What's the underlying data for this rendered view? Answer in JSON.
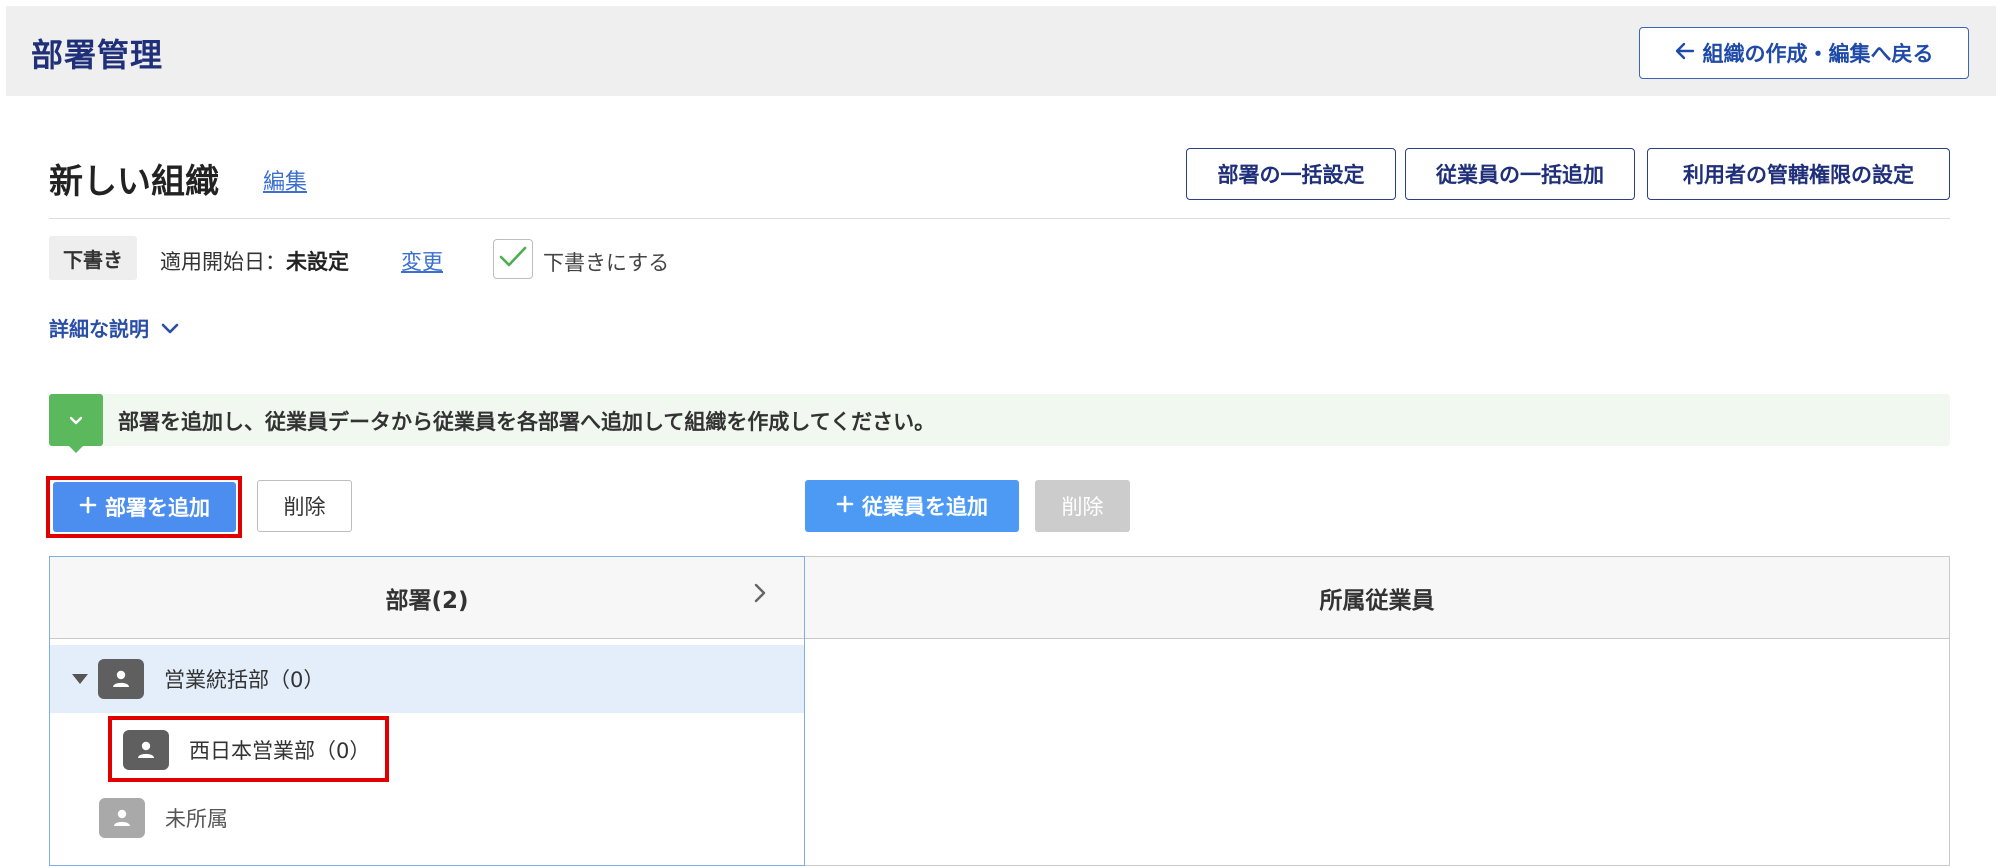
{
  "header": {
    "title": "部署管理",
    "back_button_label": "組織の作成・編集へ戻る"
  },
  "organization": {
    "name": "新しい組織",
    "edit_link": "編集"
  },
  "toolbar": {
    "bulk_dept_label": "部署の一括設定",
    "bulk_emp_label": "従業員の一括追加",
    "admin_perm_label": "利用者の管轄権限の設定"
  },
  "status": {
    "draft_badge": "下書き",
    "start_date_label": "適用開始日：",
    "start_date_value": "未設定",
    "change_link": "変更",
    "draft_checkbox_label": "下書きにする",
    "draft_checked": true
  },
  "details_toggle": "詳細な説明",
  "info_message": "部署を追加し、従業員データから従業員を各部署へ追加して組織を作成してください。",
  "actions": {
    "add_dept_label": "部署を追加",
    "delete_dept_label": "削除",
    "add_emp_label": "従業員を追加",
    "delete_emp_label": "削除"
  },
  "table": {
    "dept_header": "部署(2)",
    "members_header": "所属従業員",
    "departments": [
      {
        "label": "営業統括部（0）",
        "selected": true,
        "expanded": true,
        "level": 0
      },
      {
        "label": "西日本営業部（0）",
        "selected": false,
        "level": 1
      },
      {
        "label": "未所属",
        "selected": false,
        "level": 0,
        "muted": true
      }
    ]
  },
  "colors": {
    "primary_dark": "#1f2f7a",
    "accent_blue": "#4c8ef0",
    "info_green": "#5cb85c",
    "highlight_red": "#e00000",
    "selected_row": "#e4eefb"
  }
}
